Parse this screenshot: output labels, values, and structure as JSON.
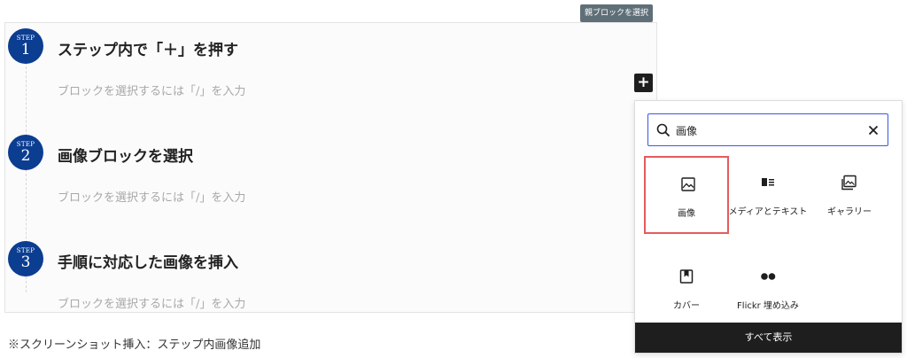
{
  "toolbar": {
    "parent_select_label": "親ブロックを選択",
    "add_block_label": "+"
  },
  "steps": [
    {
      "label": "STEP",
      "number": "1",
      "title": "ステップ内で「＋」を押す",
      "placeholder": "ブロックを選択するには「/」を入力"
    },
    {
      "label": "STEP",
      "number": "2",
      "title": "画像ブロックを選択",
      "placeholder": "ブロックを選択するには「/」を入力"
    },
    {
      "label": "STEP",
      "number": "3",
      "title": "手順に対応した画像を挿入",
      "placeholder": "ブロックを選択するには「/」を入力"
    }
  ],
  "inserter": {
    "search_value": "画像",
    "blocks": [
      {
        "name": "画像",
        "icon": "image-icon",
        "selected": true
      },
      {
        "name": "メディアとテキスト",
        "icon": "media-text-icon",
        "selected": false
      },
      {
        "name": "ギャラリー",
        "icon": "gallery-icon",
        "selected": false
      },
      {
        "name": "カバー",
        "icon": "cover-icon",
        "selected": false
      },
      {
        "name": "Flickr 埋め込み",
        "icon": "flickr-icon",
        "selected": false
      }
    ],
    "show_all_label": "すべて表示"
  },
  "caption": "※スクリーンショット挿入：ステップ内画像追加",
  "colors": {
    "step_badge": "#0b3d91",
    "selection": "#e65b5b",
    "search_focus": "#3858e9",
    "dark": "#1e1e1e"
  }
}
